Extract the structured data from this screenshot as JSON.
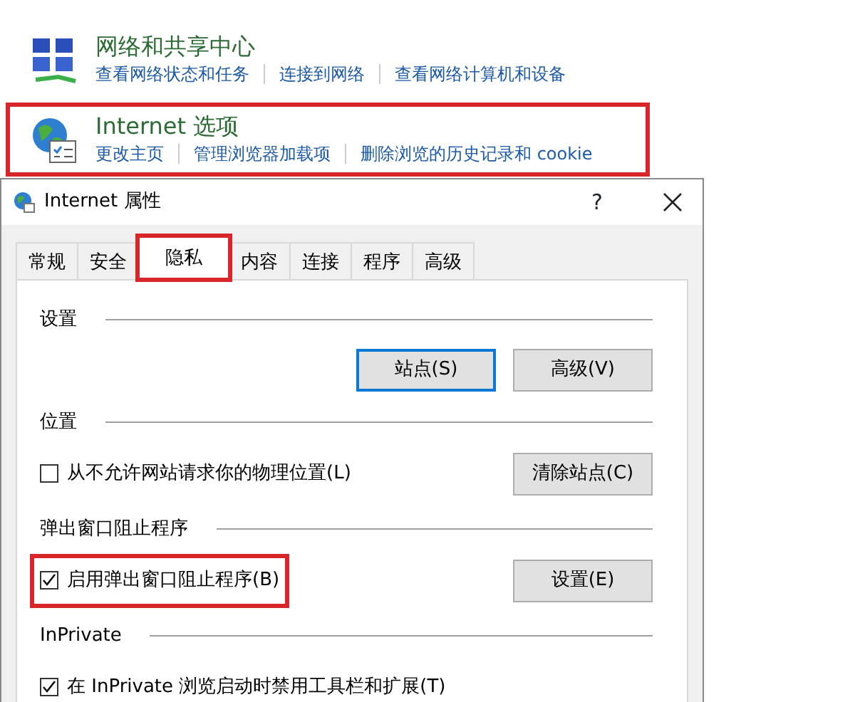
{
  "control_panel": {
    "items": [
      {
        "kind": "network",
        "title": "网络和共享中心",
        "highlighted": false,
        "links": [
          "查看网络状态和任务",
          "连接到网络",
          "查看网络计算机和设备"
        ]
      },
      {
        "kind": "internet",
        "title": "Internet 选项",
        "highlighted": true,
        "links": [
          "更改主页",
          "管理浏览器加载项",
          "删除浏览的历史记录和 cookie"
        ]
      }
    ]
  },
  "dialog": {
    "title": "Internet 属性",
    "help": "?",
    "tabs": [
      {
        "label": "常规",
        "selected": false,
        "highlighted": false
      },
      {
        "label": "安全",
        "selected": false,
        "highlighted": false
      },
      {
        "label": "隐私",
        "selected": true,
        "highlighted": true
      },
      {
        "label": "内容",
        "selected": false,
        "highlighted": false
      },
      {
        "label": "连接",
        "selected": false,
        "highlighted": false
      },
      {
        "label": "程序",
        "selected": false,
        "highlighted": false
      },
      {
        "label": "高级",
        "selected": false,
        "highlighted": false
      }
    ],
    "sections": [
      {
        "heading": "设置",
        "rows": [
          {
            "buttons": [
              {
                "label": "站点(S)",
                "default": true
              },
              {
                "label": "高级(V)",
                "default": false
              }
            ]
          }
        ]
      },
      {
        "heading": "位置",
        "rows": [
          {
            "checkbox": {
              "label": "从不允许网站请求你的物理位置(L)",
              "checked": false,
              "highlighted": false
            },
            "buttons": [
              {
                "label": "清除站点(C)",
                "default": false
              }
            ]
          }
        ]
      },
      {
        "heading": "弹出窗口阻止程序",
        "rows": [
          {
            "checkbox": {
              "label": "启用弹出窗口阻止程序(B)",
              "checked": true,
              "highlighted": true
            },
            "buttons": [
              {
                "label": "设置(E)",
                "default": false
              }
            ]
          }
        ]
      },
      {
        "heading": "InPrivate",
        "rows": [
          {
            "checkbox": {
              "label": "在 InPrivate 浏览启动时禁用工具栏和扩展(T)",
              "checked": true,
              "highlighted": false
            }
          }
        ]
      }
    ]
  }
}
